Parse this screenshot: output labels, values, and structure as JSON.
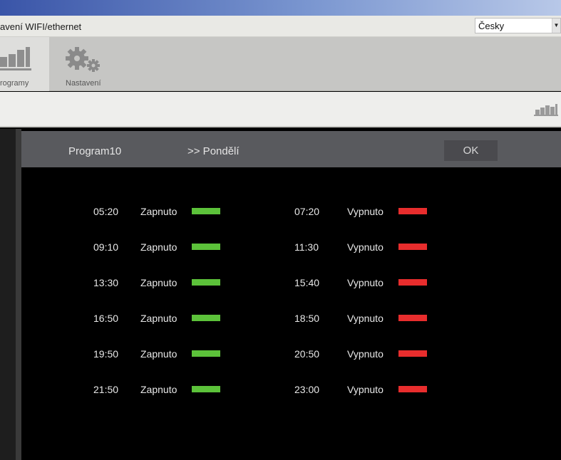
{
  "window": {
    "menu_text": "avení WIFI/ethernet",
    "language": {
      "selected": "Česky"
    }
  },
  "toolbar": {
    "items": [
      {
        "label": "rogramy",
        "icon": "bar-chart-icon",
        "active": true
      },
      {
        "label": "Nastavení",
        "icon": "gears-icon",
        "active": false
      }
    ]
  },
  "dialog": {
    "program": "Program10",
    "day": ">> Pondělí",
    "ok_label": "OK"
  },
  "schedule": {
    "rows": [
      {
        "on_time": "05:20",
        "on_label": "Zapnuto",
        "off_time": "07:20",
        "off_label": "Vypnuto"
      },
      {
        "on_time": "09:10",
        "on_label": "Zapnuto",
        "off_time": "11:30",
        "off_label": "Vypnuto"
      },
      {
        "on_time": "13:30",
        "on_label": "Zapnuto",
        "off_time": "15:40",
        "off_label": "Vypnuto"
      },
      {
        "on_time": "16:50",
        "on_label": "Zapnuto",
        "off_time": "18:50",
        "off_label": "Vypnuto"
      },
      {
        "on_time": "19:50",
        "on_label": "Zapnuto",
        "off_time": "20:50",
        "off_label": "Vypnuto"
      },
      {
        "on_time": "21:50",
        "on_label": "Zapnuto",
        "off_time": "23:00",
        "off_label": "Vypnuto"
      }
    ]
  },
  "colors": {
    "on": "#5cc23a",
    "off": "#e82d2d",
    "header_bg": "#595a5e"
  }
}
